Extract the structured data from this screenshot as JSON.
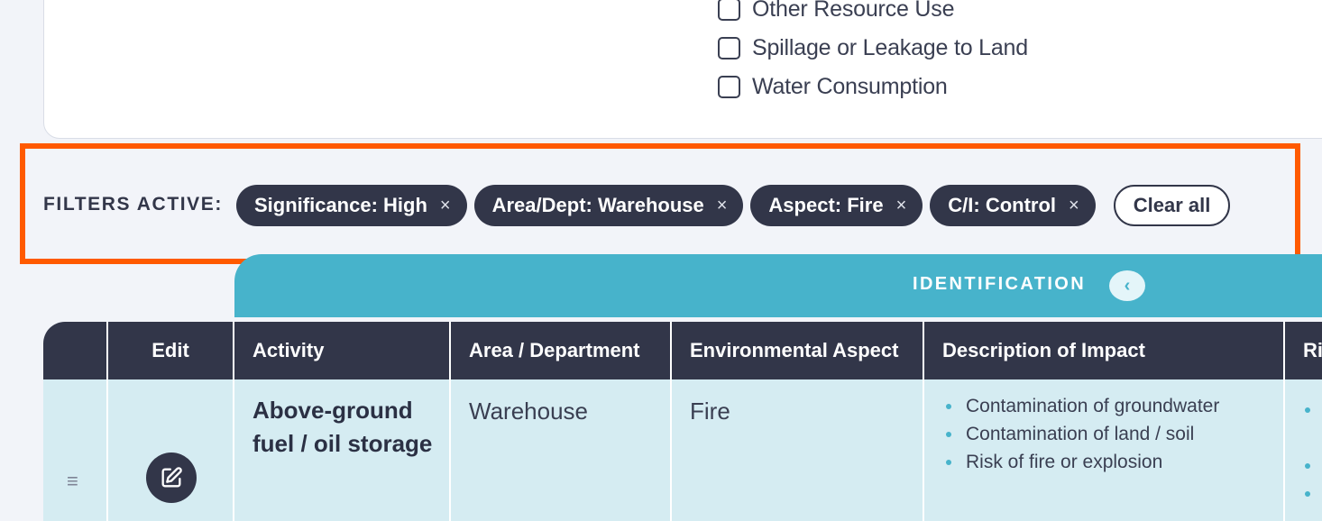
{
  "filter_options": [
    {
      "label": "Other Resource Use",
      "checked": false
    },
    {
      "label": "Spillage or Leakage to Land",
      "checked": false
    },
    {
      "label": "Water Consumption",
      "checked": false
    }
  ],
  "active_filters": {
    "label": "FILTERS ACTIVE:",
    "chips": [
      {
        "label": "Significance: High",
        "remove_icon": "×"
      },
      {
        "label": "Area/Dept: Warehouse",
        "remove_icon": "×"
      },
      {
        "label": "Aspect: Fire",
        "remove_icon": "×"
      },
      {
        "label": "C/I: Control",
        "remove_icon": "×"
      }
    ],
    "clear_all_label": "Clear all",
    "highlight_color": "#ff5a00"
  },
  "section_header": {
    "title": "IDENTIFICATION",
    "collapse_icon": "‹",
    "color": "#47b3cb"
  },
  "table": {
    "columns": [
      "",
      "Edit",
      "Activity",
      "Area / Department",
      "Environmental Aspect",
      "Description of Impact",
      "Ri"
    ],
    "rows": [
      {
        "drag_icon": "≡",
        "activity": "Above-ground fuel / oil storage",
        "area": "Warehouse",
        "aspect": "Fire",
        "impacts": [
          "Contamination of groundwater",
          "Contamination of land / soil",
          "Risk of fire or explosion"
        ]
      }
    ],
    "header_color": "#323649",
    "row_color": "#d5ecf2"
  }
}
